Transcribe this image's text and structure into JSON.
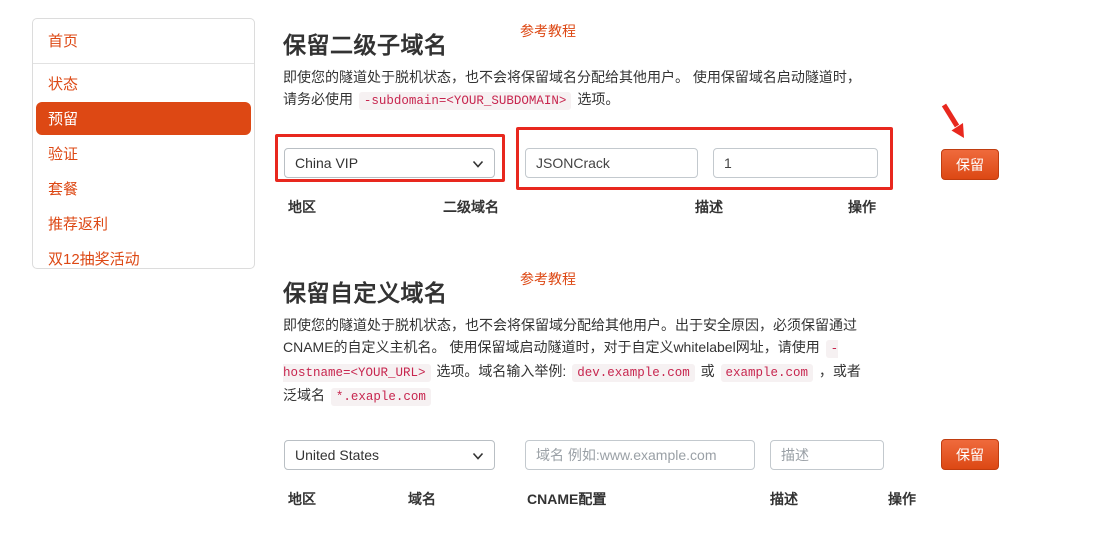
{
  "colors": {
    "accent_orange": "#dd4814",
    "annotation_red": "#e8281e",
    "code_text": "#c7254e",
    "button_gradient_top": "#ef6a3c",
    "button_gradient_bottom": "#dc4814"
  },
  "sidebar": {
    "items": [
      {
        "label": "首页",
        "active": false
      },
      {
        "label": "状态",
        "active": false
      },
      {
        "label": "预留",
        "active": true
      },
      {
        "label": "验证",
        "active": false
      },
      {
        "label": "套餐",
        "active": false
      },
      {
        "label": "推荐返利",
        "active": false
      },
      {
        "label": "双12抽奖活动",
        "active": false
      }
    ]
  },
  "subdomain_section": {
    "title": "保留二级子域名",
    "tutorial_link": "参考教程",
    "description": "即使您的隧道处于脱机状态，也不会将保留域名分配给其他用户。 使用保留域名启动隧道时，请务必使用 `-subdomain=<YOUR_SUBDOMAIN>` 选项。",
    "form": {
      "region_value": "China VIP",
      "subdomain_value": "JSONCrack",
      "description_value": "1",
      "submit_label": "保留"
    },
    "columns": [
      "地区",
      "二级域名",
      "描述",
      "操作"
    ]
  },
  "customdomain_section": {
    "title": "保留自定义域名",
    "tutorial_link": "参考教程",
    "description": "即使您的隧道处于脱机状态，也不会将保留域分配给其他用户。出于安全原因，必须保留通过CNAME的自定义主机名。 使用保留域启动隧道时，对于自定义whitelabel网址，请使用 `-hostname=<YOUR_URL>` 选项。域名输入举例: `dev.example.com` 或 `example.com` ，或者泛域名 `*.exaple.com`",
    "form": {
      "region_value": "United States",
      "domain_placeholder": "域名 例如:www.example.com",
      "description_placeholder": "描述",
      "submit_label": "保留"
    },
    "columns": [
      "地区",
      "域名",
      "CNAME配置",
      "描述",
      "操作"
    ]
  }
}
